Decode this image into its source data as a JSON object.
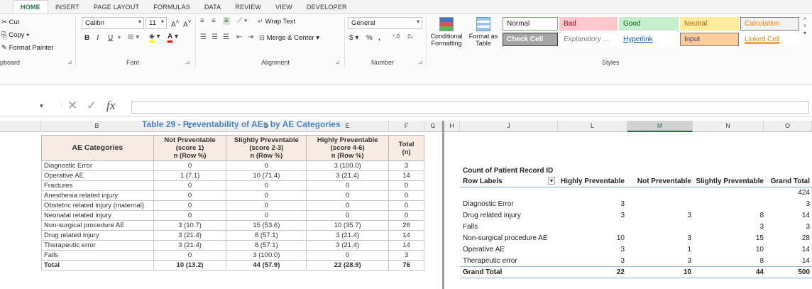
{
  "ribbon_tabs": [
    "HOME",
    "INSERT",
    "PAGE LAYOUT",
    "FORMULAS",
    "DATA",
    "REVIEW",
    "VIEW",
    "DEVELOPER"
  ],
  "clipboard": {
    "cut": "Cut",
    "copy": "Copy",
    "format_painter": "Format Painter",
    "group": "pboard"
  },
  "font": {
    "name": "Calibri",
    "size": "11",
    "group": "Font",
    "bold": "B",
    "italic": "I",
    "underline": "U"
  },
  "alignment": {
    "wrap_text": "Wrap Text",
    "merge_center": "Merge & Center",
    "group": "Alignment"
  },
  "number": {
    "format": "General",
    "currency": "$",
    "percent": "%",
    "comma": ",",
    "group": "Number"
  },
  "styles": {
    "conditional_formatting": "Conditional Formatting",
    "format_as_table": "Format as Table",
    "group": "Styles",
    "cells": [
      {
        "label": "Normal",
        "bg": "#ffffff",
        "fg": "#222222",
        "border": "#77aa77"
      },
      {
        "label": "Bad",
        "bg": "#ffc7ce",
        "fg": "#9c0006",
        "border": "#ffc7ce"
      },
      {
        "label": "Good",
        "bg": "#c6efce",
        "fg": "#006100",
        "border": "#c6efce"
      },
      {
        "label": "Neutral",
        "bg": "#ffeb9c",
        "fg": "#9c6500",
        "border": "#ffeb9c"
      },
      {
        "label": "Calculation",
        "bg": "#f2f2f2",
        "fg": "#fa7d00",
        "border": "#7f7f7f"
      },
      {
        "label": "Check Cell",
        "bg": "#a5a5a5",
        "fg": "#ffffff",
        "border": "#3f3f3f"
      },
      {
        "label": "Explanatory ...",
        "bg": "#ffffff",
        "fg": "#7f7f7f",
        "border": "#ffffff"
      },
      {
        "label": "Hyperlink",
        "bg": "#ffffff",
        "fg": "#0563c1",
        "border": "#ffffff"
      },
      {
        "label": "Input",
        "bg": "#ffcc99",
        "fg": "#3f3f76",
        "border": "#7f7f7f"
      },
      {
        "label": "Linked Cell",
        "bg": "#ffffff",
        "fg": "#fa7d00",
        "border": "#ffffff"
      }
    ]
  },
  "formula_bar": {
    "fx": "fx",
    "value": ""
  },
  "columns_left": [
    "B",
    "C",
    "D",
    "E",
    "F",
    "G"
  ],
  "columns_right": [
    "H",
    "J",
    "L",
    "M",
    "N",
    "O"
  ],
  "left_table": {
    "title": "Table 29 - Preventability of AEs by AE Categories",
    "headers": [
      "AE Categories",
      "Not Preventable (score 1) n (Row %)",
      "Slightly Preventable (score 2-3) n (Row %)",
      "Highly Preventable (score 4-6) n (Row %)",
      "Total (n)"
    ],
    "header_lines": [
      [
        "AE Categories"
      ],
      [
        "Not Preventable",
        "(score 1)",
        "n (Row %)"
      ],
      [
        "Slightly Preventable",
        "(score 2-3)",
        "n (Row %)"
      ],
      [
        "Highly Preventable",
        "(score 4-6)",
        "n (Row %)"
      ],
      [
        "Total",
        "(n)"
      ]
    ],
    "rows": [
      [
        "Diagnostic Error",
        "0",
        "0",
        "3 (100.0)",
        "3"
      ],
      [
        "Operative AE",
        "1 (7.1)",
        "10 (71.4)",
        "3 (21.4)",
        "14"
      ],
      [
        "Fractures",
        "0",
        "0",
        "0",
        "0"
      ],
      [
        "Anesthesia related injury",
        "0",
        "0",
        "0",
        "0"
      ],
      [
        "Obstetric related injury (maternal)",
        "0",
        "0",
        "0",
        "0"
      ],
      [
        "Neonatal related injury",
        "0",
        "0",
        "0",
        "0"
      ],
      [
        "Non-surgical procedure AE",
        "3 (10.7)",
        "15 (53.6)",
        "10 (35.7)",
        "28"
      ],
      [
        "Drug related injury",
        "3 (21.4)",
        "8 (57.1)",
        "3 (21.4)",
        "14"
      ],
      [
        "Therapeutic error",
        "3 (21.4)",
        "8 (57.1)",
        "3 (21.4)",
        "14"
      ],
      [
        "Falls",
        "0",
        "3 (100.0)",
        "0",
        "3"
      ]
    ],
    "total": [
      "Total",
      "10 (13.2)",
      "44 (57.9)",
      "22 (28.9)",
      "76"
    ]
  },
  "pivot": {
    "title": "Count of Patient Record ID",
    "row_labels": "Row Labels",
    "columns": [
      "Highly Preventable",
      "Not Preventable",
      "Slightly Preventable",
      "Grand Total"
    ],
    "rows": [
      {
        "label": "",
        "values": [
          "",
          "",
          "",
          "424"
        ]
      },
      {
        "label": "Diagnostic Error",
        "values": [
          "3",
          "",
          "",
          "3"
        ]
      },
      {
        "label": "Drug related injury",
        "values": [
          "3",
          "3",
          "8",
          "14"
        ]
      },
      {
        "label": "Falls",
        "values": [
          "",
          "",
          "3",
          "3"
        ]
      },
      {
        "label": "Non-surgical procedure AE",
        "values": [
          "10",
          "3",
          "15",
          "28"
        ]
      },
      {
        "label": "Operative AE",
        "values": [
          "3",
          "1",
          "10",
          "14"
        ]
      },
      {
        "label": "Therapeutic error",
        "values": [
          "3",
          "3",
          "8",
          "14"
        ]
      }
    ],
    "grand_total": {
      "label": "Grand Total",
      "values": [
        "22",
        "10",
        "44",
        "500"
      ]
    }
  }
}
